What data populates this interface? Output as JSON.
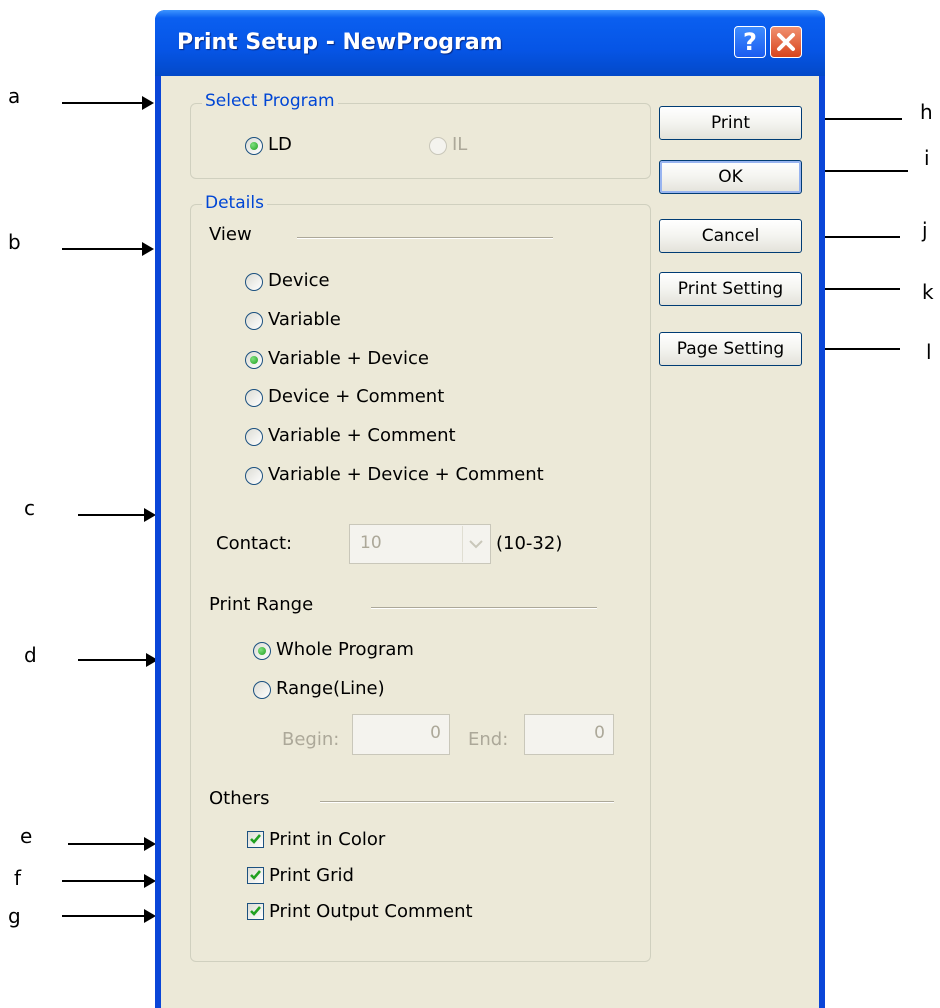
{
  "annotations": {
    "a": "a",
    "b": "b",
    "c": "c",
    "d": "d",
    "e": "e",
    "f": "f",
    "g": "g",
    "h": "h",
    "i": "i",
    "j": "j",
    "k": "k",
    "l": "l"
  },
  "window": {
    "title": "Print Setup - NewProgram",
    "help_glyph": "?",
    "close_icon": "close-icon"
  },
  "select_program": {
    "legend": "Select Program",
    "options": [
      {
        "label": "LD",
        "checked": true,
        "enabled": true
      },
      {
        "label": "IL",
        "checked": false,
        "enabled": false
      }
    ]
  },
  "details": {
    "legend": "Details",
    "view": {
      "heading": "View",
      "options": [
        {
          "label": "Device",
          "checked": false
        },
        {
          "label": "Variable",
          "checked": false
        },
        {
          "label": "Variable + Device",
          "checked": true
        },
        {
          "label": "Device + Comment",
          "checked": false
        },
        {
          "label": "Variable + Comment",
          "checked": false
        },
        {
          "label": "Variable +  Device +  Comment",
          "checked": false
        }
      ]
    },
    "contact": {
      "label": "Contact:",
      "value": "10",
      "range": "(10-32)"
    },
    "print_range": {
      "heading": "Print Range",
      "options": [
        {
          "label": "Whole Program",
          "checked": true
        },
        {
          "label": "Range(Line)",
          "checked": false
        }
      ],
      "begin_label": "Begin:",
      "begin_value": "0",
      "end_label": "End:",
      "end_value": "0"
    },
    "others": {
      "heading": "Others",
      "checks": [
        {
          "label": "Print in Color",
          "checked": true
        },
        {
          "label": "Print Grid",
          "checked": true
        },
        {
          "label": "Print Output Comment",
          "checked": true
        }
      ]
    }
  },
  "buttons": {
    "print": "Print",
    "ok": "OK",
    "cancel": "Cancel",
    "print_setting": "Print Setting",
    "page_setting": "Page Setting"
  },
  "colors": {
    "title_bar": "#0655e6",
    "legend_text": "#0046d5",
    "dialog_bg": "#ece9d8",
    "radio_dot": "#21a121"
  }
}
